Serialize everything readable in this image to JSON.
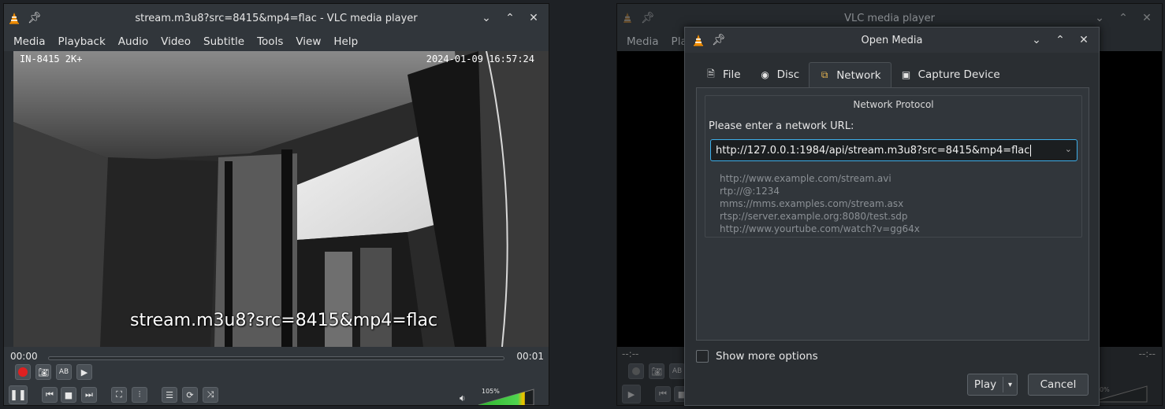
{
  "player": {
    "title": "stream.m3u8?src=8415&mp4=flac - VLC media player",
    "menu": [
      "Media",
      "Playback",
      "Audio",
      "Video",
      "Subtitle",
      "Tools",
      "View",
      "Help"
    ],
    "osd_camera": "IN-8415 2K+",
    "osd_timestamp": "2024-01-09 16:57:24",
    "osd_title": "stream.m3u8?src=8415&mp4=flac",
    "elapsed": "00:00",
    "remaining": "00:01",
    "volume_label": "105%",
    "volume_level": 1.05
  },
  "background_player": {
    "title": "VLC media player",
    "menu": [
      "Media",
      "Playback"
    ],
    "elapsed": "--:--",
    "remaining": "--:--",
    "volume_label": "0%"
  },
  "dialog": {
    "title": "Open Media",
    "tabs": {
      "file": "File",
      "disc": "Disc",
      "network": "Network",
      "capture": "Capture Device"
    },
    "group_title": "Network Protocol",
    "prompt": "Please enter a network URL:",
    "url_value": "http://127.0.0.1:1984/api/stream.m3u8?src=8415&mp4=flac",
    "examples": [
      "http://www.example.com/stream.avi",
      "rtp://@:1234",
      "mms://mms.examples.com/stream.asx",
      "rtsp://server.example.org:8080/test.sdp",
      "http://www.yourtube.com/watch?v=gg64x"
    ],
    "show_more": "Show more options",
    "play_label": "Play",
    "cancel_label": "Cancel"
  },
  "colors": {
    "accent": "#3daee9",
    "record": "#e02020",
    "volume_green": "#3ac93a"
  }
}
